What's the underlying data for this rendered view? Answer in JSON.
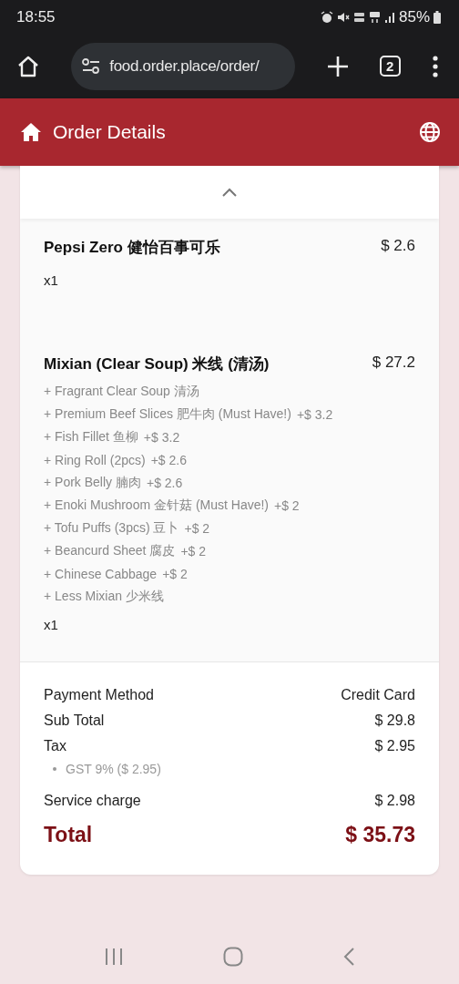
{
  "status_bar": {
    "time": "18:55",
    "battery": "85%"
  },
  "browser": {
    "url": "food.order.place/order/",
    "tab_count": "2"
  },
  "header": {
    "title": "Order Details"
  },
  "items": [
    {
      "name": "Pepsi Zero 健怡百事可乐",
      "price": "$ 2.6",
      "quantity": "x1"
    },
    {
      "name": "Mixian (Clear Soup) 米线 (清汤)",
      "price": "$ 27.2",
      "addons": [
        {
          "name": "+ Fragrant Clear Soup 清汤"
        },
        {
          "name": "+ Premium Beef Slices 肥牛肉 (Must Have!)",
          "price": "+$ 3.2"
        },
        {
          "name": "+ Fish Fillet 鱼柳",
          "price": "+$ 3.2"
        },
        {
          "name": "+ Ring Roll (2pcs)",
          "price": "+$ 2.6"
        },
        {
          "name": "+ Pork Belly 腩肉",
          "price": "+$ 2.6"
        },
        {
          "name": "+ Enoki Mushroom 金针菇 (Must Have!)",
          "price": "+$ 2"
        },
        {
          "name": "+ Tofu Puffs (3pcs) 豆卜",
          "price": "+$ 2"
        },
        {
          "name": "+ Beancurd Sheet 腐皮",
          "price": "+$ 2"
        },
        {
          "name": "+ Chinese Cabbage",
          "price": "+$ 2"
        },
        {
          "name": "+ Less Mixian 少米线"
        }
      ],
      "quantity": "x1"
    }
  ],
  "summary": [
    {
      "label": "Payment Method",
      "value": "Credit Card"
    },
    {
      "label": "Sub Total",
      "value": "$ 29.8"
    },
    {
      "label": "Tax",
      "value": "$ 2.95",
      "details": [
        "GST 9% ($ 2.95)"
      ]
    },
    {
      "label": "Service charge",
      "value": "$ 2.98"
    }
  ],
  "total": {
    "label": "Total",
    "value": "$ 35.73"
  }
}
